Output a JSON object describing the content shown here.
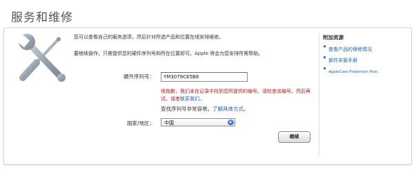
{
  "page": {
    "title": "服务和维修"
  },
  "intro": {
    "line1": "您可以查看自己的服务选项，然后针对所选产品和位置在线安排维修。",
    "line2": "要继续操作，只需提供您的硬件序列号和所在位置即可。Apple 将会为您安排所需帮助。"
  },
  "form": {
    "serial_label": "硬件序列号：",
    "serial_value": "YM3079CE5B8",
    "error_text": "很抱歉，我们未在记录中找到您所提供的编号。请检查该编号，然后再试，或者",
    "error_link": "联系我们",
    "error_end": "。",
    "help_text": "查找序列号非常容易。",
    "help_link": "了解具体方式。",
    "country_label": "国家/地区：",
    "country_value": "中国",
    "continue_label": "继续"
  },
  "sidebar": {
    "title": "附加资源",
    "items": [
      {
        "label": "查看产品的保修情况"
      },
      {
        "label": "部件安装手册"
      },
      {
        "label": "AppleCare Protection Plan"
      }
    ]
  },
  "colors": {
    "link": "#1d5fb4",
    "error": "#b41d1d",
    "icon": "#9aa4b0"
  },
  "icons": {
    "tools": "wrench-screwdriver-icon",
    "dropdown": "chevron-down-icon",
    "bullet": "square-bullet-icon"
  }
}
